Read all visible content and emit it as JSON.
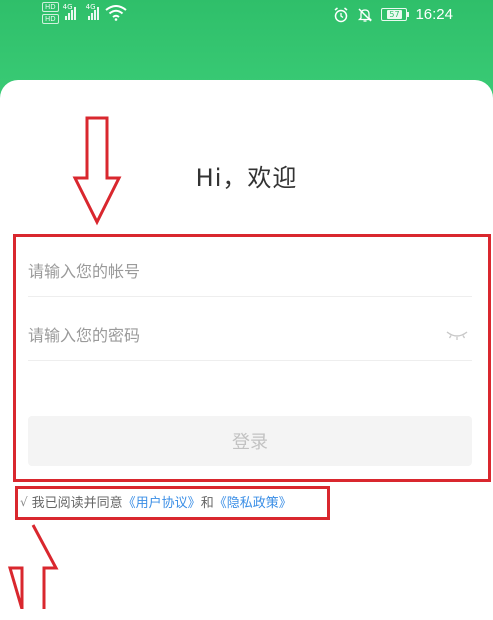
{
  "status_bar": {
    "hd_badge": "HD",
    "net_gen_1": "4G",
    "net_gen_2": "4G",
    "battery": "57",
    "time": "16:24",
    "icons": [
      "hd-icon",
      "signal-icon",
      "wifi-icon",
      "alarm-icon",
      "mute-icon",
      "battery-icon"
    ]
  },
  "login": {
    "greeting": "Hi，欢迎",
    "account_placeholder": "请输入您的帐号",
    "password_placeholder": "请输入您的密码",
    "login_label": "登录",
    "agreement": {
      "check_mark": "√",
      "prefix": "我已阅读并同意",
      "user_agreement": "《用户协议》",
      "conjunction": "和",
      "privacy_policy": "《隐私政策》"
    }
  },
  "colors": {
    "header_green": "#2fbf6a",
    "annotation_red": "#d9272e",
    "link_blue": "#3a8ee6"
  }
}
